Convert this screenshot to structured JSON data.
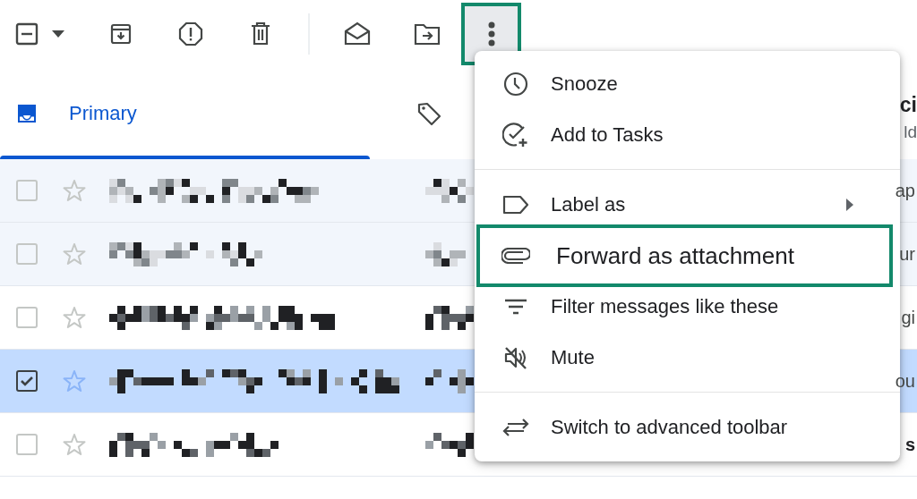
{
  "toolbar": {
    "select_all": {
      "partial": true
    },
    "more_button": {
      "highlighted": true
    }
  },
  "tabs": [
    {
      "label": "Primary",
      "selected": true
    },
    {
      "selected": false
    },
    {
      "label": "ci",
      "subtitle": "ld",
      "selected": false
    }
  ],
  "rows": [
    {
      "read": true,
      "selected": false,
      "checked": false,
      "starred": false,
      "snippet_end": "ap",
      "bold": false
    },
    {
      "read": true,
      "selected": false,
      "checked": false,
      "starred": false,
      "snippet_end": "ur",
      "bold": false
    },
    {
      "read": false,
      "selected": false,
      "checked": false,
      "starred": false,
      "snippet_end": "gi",
      "bold": false
    },
    {
      "read": false,
      "selected": true,
      "checked": true,
      "starred": false,
      "snippet_end": "ou",
      "bold": false
    },
    {
      "read": false,
      "selected": false,
      "checked": false,
      "starred": false,
      "snippet_end": "s",
      "bold": true
    }
  ],
  "menu": {
    "sections": [
      {
        "items": [
          {
            "label": "Snooze",
            "submenu": false,
            "highlighted": false
          },
          {
            "label": "Add to Tasks",
            "submenu": false,
            "highlighted": false
          }
        ]
      },
      {
        "items": [
          {
            "label": "Label as",
            "submenu": true,
            "highlighted": false
          },
          {
            "label": "Forward as attachment",
            "submenu": false,
            "highlighted": true
          },
          {
            "label": "Filter messages like these",
            "submenu": false,
            "highlighted": false
          },
          {
            "label": "Mute",
            "submenu": false,
            "highlighted": false
          }
        ]
      },
      {
        "items": [
          {
            "label": "Switch to advanced toolbar",
            "submenu": false,
            "highlighted": false
          }
        ]
      }
    ]
  }
}
